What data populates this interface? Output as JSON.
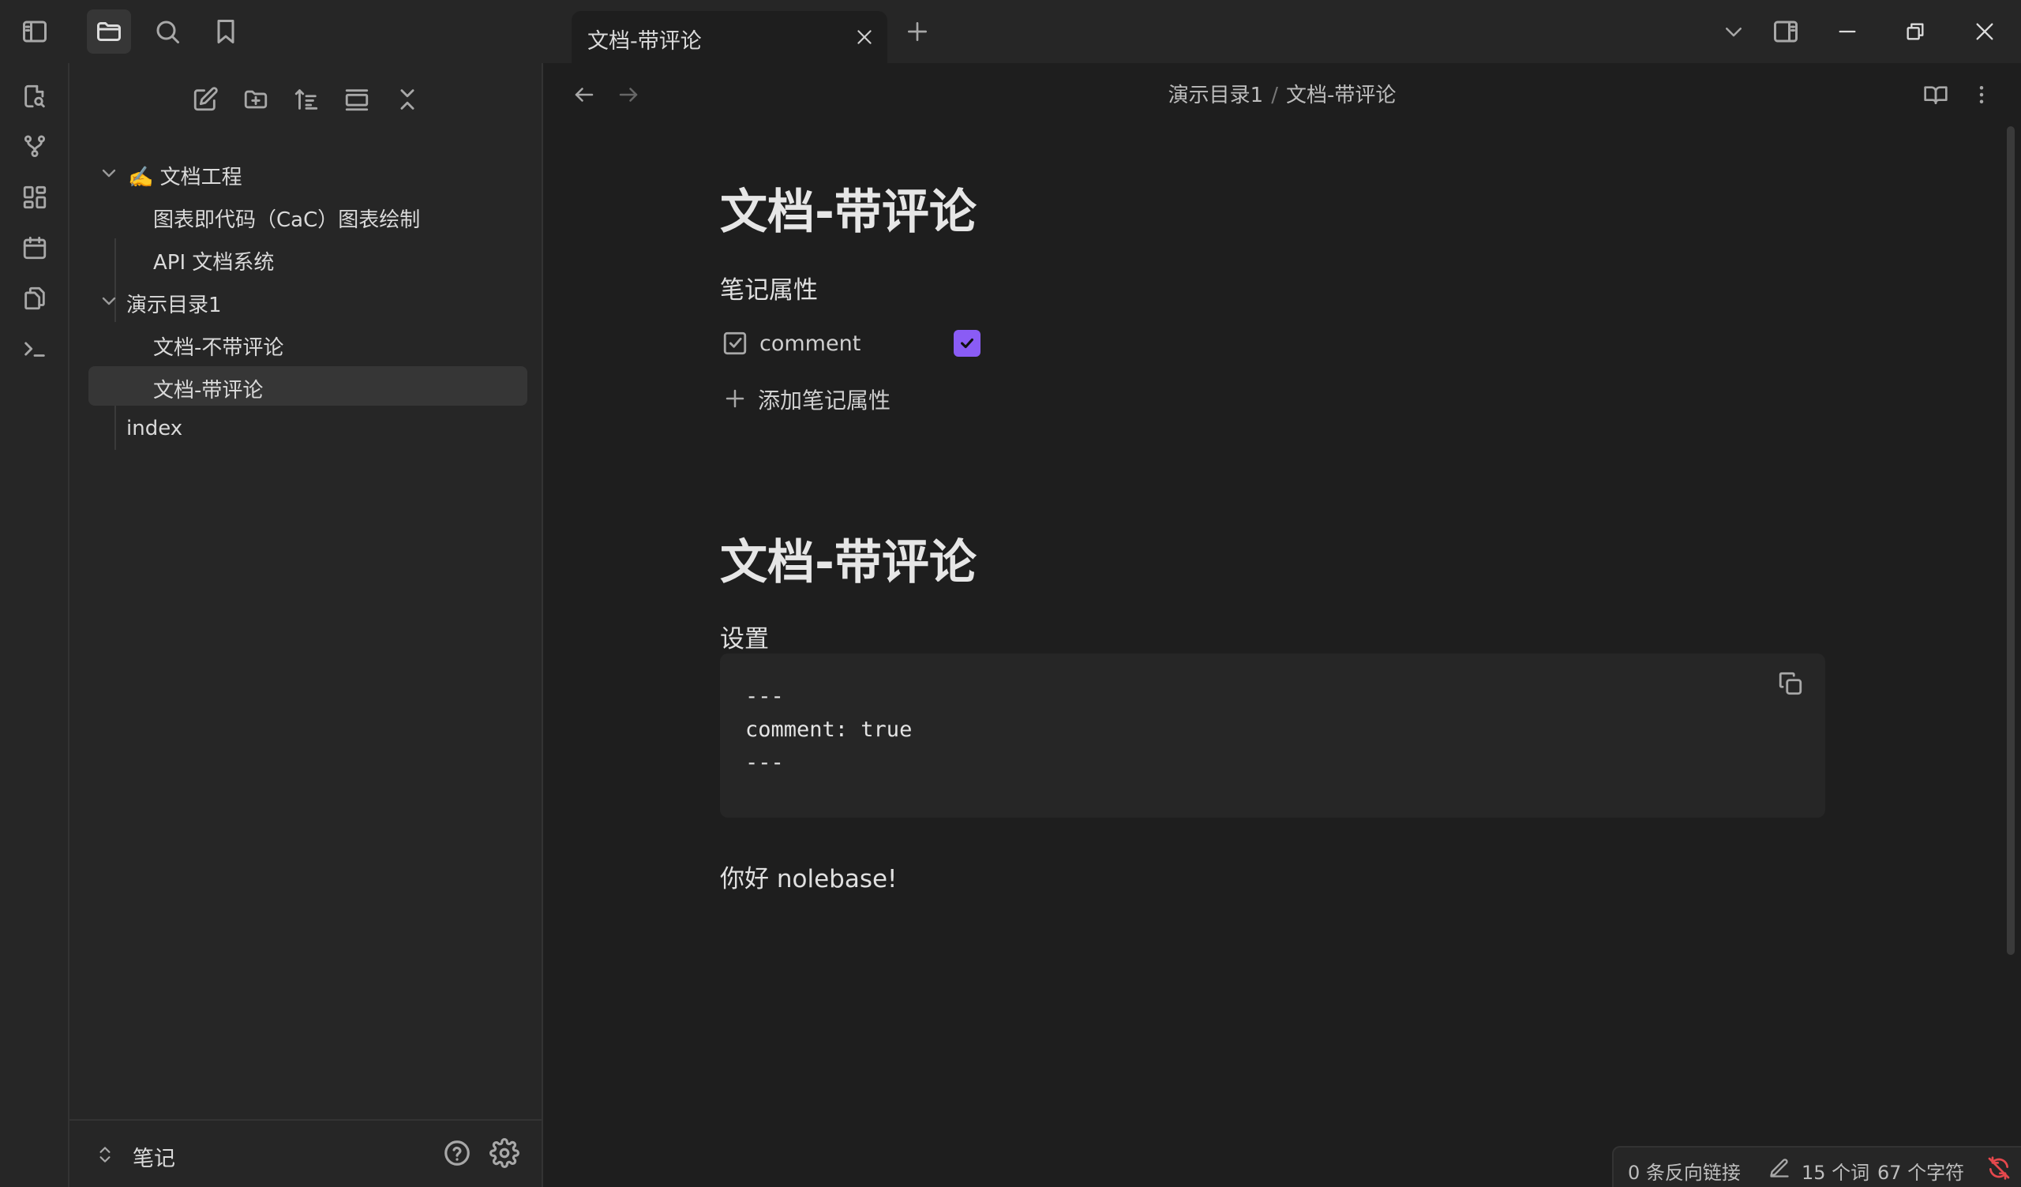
{
  "window": {
    "tab_title": "文档-带评论"
  },
  "breadcrumb": {
    "folder": "演示目录1",
    "separator": "/",
    "file": "文档-带评论"
  },
  "file_tree": {
    "items": [
      {
        "label": "✍️ 文档工程",
        "type": "folder",
        "expanded": true
      },
      {
        "label": "图表即代码（CaC）图表绘制",
        "type": "file"
      },
      {
        "label": "API 文档系统",
        "type": "file"
      },
      {
        "label": "演示目录1",
        "type": "folder",
        "expanded": true
      },
      {
        "label": "文档-不带评论",
        "type": "file"
      },
      {
        "label": "文档-带评论",
        "type": "file",
        "selected": true
      },
      {
        "label": "index",
        "type": "file"
      }
    ]
  },
  "vault": {
    "name": "笔记"
  },
  "document": {
    "inline_title": "文档-带评论",
    "properties_heading": "笔记属性",
    "property": {
      "key": "comment",
      "checked": true
    },
    "add_property_label": "添加笔记属性",
    "h1": "文档-带评论",
    "settings_label": "设置",
    "code_lines": [
      "---",
      "comment: true",
      "---"
    ],
    "body_text": "你好 nolebase!"
  },
  "status_bar": {
    "backlinks": "0 条反向链接",
    "words": "15 个词",
    "chars": "67 个字符"
  },
  "colors": {
    "accent": "#8a5cf5",
    "background": "#1e1e1e",
    "panel": "#262626",
    "sync_error": "#e5484d"
  }
}
